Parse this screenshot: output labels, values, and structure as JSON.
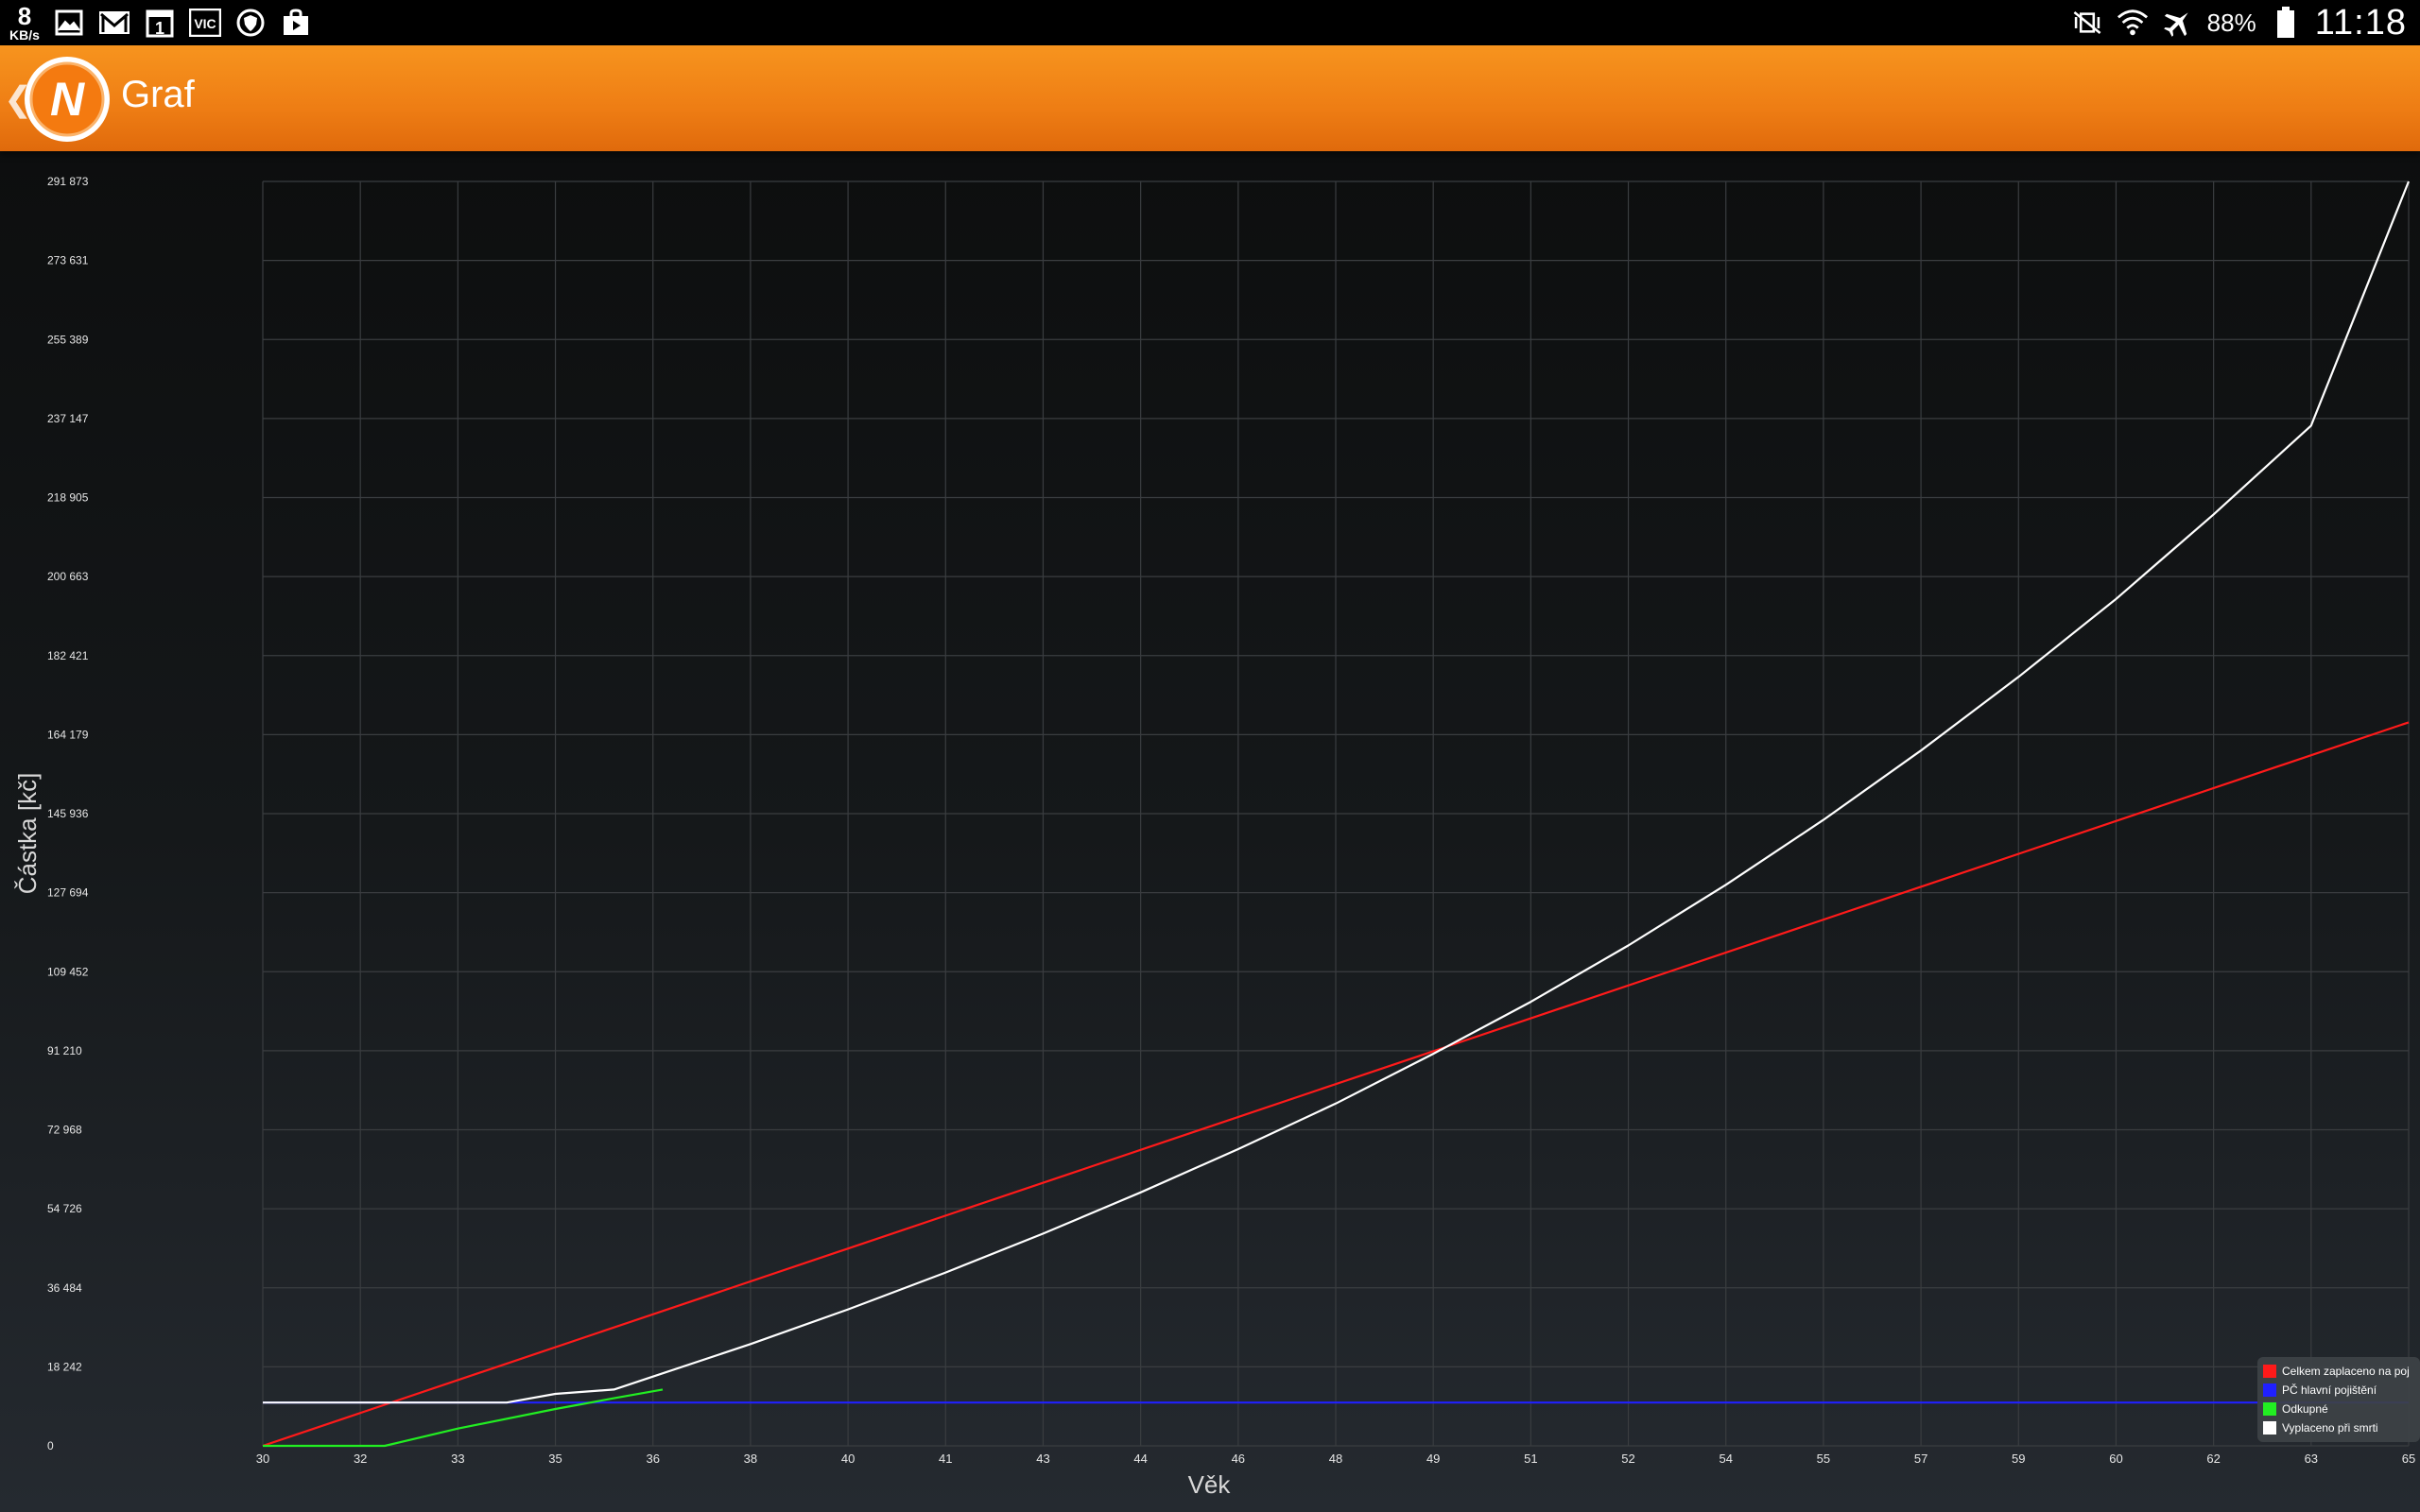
{
  "status_bar": {
    "speed_value": "8",
    "speed_unit": "KB/s",
    "left_icons": [
      "image-icon",
      "gmail-icon",
      "calendar-icon",
      "vic-icon",
      "vpn-shield-icon",
      "store-bag-icon"
    ],
    "calendar_day": "1",
    "vic_label": "VIC",
    "right_icons": [
      "vibrate-icon",
      "wifi-icon",
      "airplane-icon",
      "battery-icon"
    ],
    "battery_percent": "88%",
    "time": "11:18"
  },
  "app_bar": {
    "title": "Graf",
    "logo_letter": "N",
    "colors": {
      "bar": "#f08217",
      "logo_ring": "#ffffff",
      "logo_fill": "#f47a10"
    }
  },
  "chart_data": {
    "type": "line",
    "xlabel": "Věk",
    "ylabel": "Částka [kč]",
    "x_ticks": [
      "30",
      "32",
      "33",
      "35",
      "36",
      "38",
      "40",
      "41",
      "43",
      "44",
      "46",
      "48",
      "49",
      "51",
      "52",
      "54",
      "55",
      "57",
      "59",
      "60",
      "62",
      "63",
      "65"
    ],
    "x_positions": [
      30,
      31,
      32,
      33,
      34,
      35,
      36,
      37,
      38,
      39,
      40,
      41,
      42,
      43,
      44,
      45,
      46,
      47,
      48,
      49,
      50,
      51,
      52
    ],
    "y_ticks": [
      "0",
      "18 242",
      "36 484",
      "54 726",
      "72 968",
      "91 210",
      "109 452",
      "127 694",
      "145 936",
      "164 179",
      "182 421",
      "200 663",
      "218 905",
      "237 147",
      "255 389",
      "273 631",
      "291 873"
    ],
    "ylim": [
      0,
      291873
    ],
    "xlim": [
      30,
      52
    ],
    "grid": true,
    "legend_position": "bottom-right",
    "series": [
      {
        "name": "Celkem zaplaceno na poj",
        "color": "#ff1a1a",
        "x": [
          30,
          52
        ],
        "y": [
          0,
          167000
        ]
      },
      {
        "name": "PČ hlavní pojištění",
        "color": "#2020ff",
        "x": [
          30,
          52
        ],
        "y": [
          10000,
          10000
        ]
      },
      {
        "name": "Odkupné",
        "color": "#22ee22",
        "x": [
          30,
          31.25,
          32,
          33,
          33.6,
          34.1
        ],
        "y": [
          0,
          0,
          4000,
          8500,
          11000,
          13000
        ]
      },
      {
        "name": "Vyplaceno při smrti",
        "color": "#ffffff",
        "x": [
          30,
          32.5,
          33,
          33.6,
          34,
          35,
          36,
          37,
          38,
          39,
          40,
          41,
          42,
          43,
          44,
          45,
          46,
          47,
          48,
          49,
          50,
          51,
          52
        ],
        "y": [
          10000,
          10000,
          12000,
          13000,
          16000,
          23500,
          31500,
          40000,
          49000,
          58500,
          68500,
          79000,
          90500,
          102500,
          115500,
          129500,
          144500,
          160500,
          177500,
          195500,
          215000,
          235500,
          291873
        ]
      }
    ]
  }
}
